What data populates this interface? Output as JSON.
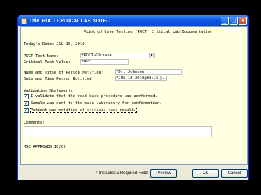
{
  "window": {
    "title": "Title: POCT CRITICAL LAB NOTE-T"
  },
  "titlebar_buttons": {
    "minimize": "_",
    "maximize": "□",
    "close": "✕"
  },
  "form": {
    "heading": "Point of Care Testing (POCT) Critical Lab Documentation",
    "todays_date": "Today's Date: JUL 16, 2010",
    "poct_test_label": "POCT Test Name:",
    "poct_test_value": "*POCT-Glucose",
    "critical_value_label": "Critical Test Value:",
    "critical_value": "*495",
    "notified_label": "Name and Title of Person Notified:",
    "notified_value": "*Dr. Johnson",
    "datetime_label": "Date and Time Person Notified:",
    "datetime_value": "*JUL 16,2010@08:15",
    "datetime_button": "...",
    "validation_label": "Validation Statements:",
    "validations": [
      {
        "text": "I validate that the read back procedure was performed.",
        "checked": true
      },
      {
        "text": "Sample was sent to the main laboratory for confirmation.",
        "checked": true
      },
      {
        "text": "Patient was notified of critical test result.",
        "checked": true
      }
    ],
    "comments_label": "Comments:",
    "comments_value": "",
    "footer_note": "MSC APPROVED 10/09"
  },
  "status": {
    "required_note": "* Indicates a Required Field",
    "preview_label": "Preview",
    "ok_label": "OK",
    "cancel_label": "Cancel"
  }
}
